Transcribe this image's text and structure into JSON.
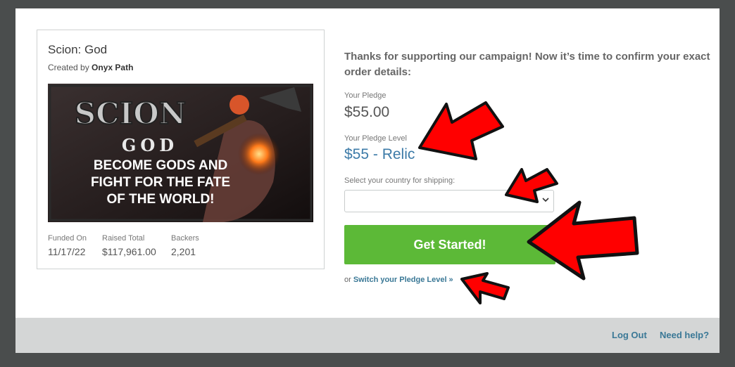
{
  "campaign": {
    "title": "Scion: God",
    "created_by_label": "Created by",
    "creator": "Onyx Path",
    "banner": {
      "logo": "SCION",
      "subtitle": "GOD",
      "tagline_1": "BECOME GODS AND",
      "tagline_2": "FIGHT FOR THE FATE",
      "tagline_3": "OF THE WORLD!"
    },
    "stats": [
      {
        "label": "Funded On",
        "value": "11/17/22"
      },
      {
        "label": "Raised Total",
        "value": "$117,961.00"
      },
      {
        "label": "Backers",
        "value": "2,201"
      }
    ]
  },
  "order": {
    "intro": "Thanks for supporting our campaign! Now it’s time to confirm your exact order details:",
    "pledge_label": "Your Pledge",
    "pledge_amount": "$55.00",
    "level_label": "Your Pledge Level",
    "level_value": "$55 - Relic",
    "country_label": "Select your country for shipping:",
    "country_value": "",
    "get_started": "Get Started!",
    "switch_prefix": "or",
    "switch_link": "Switch your Pledge Level »"
  },
  "footer": {
    "logout": "Log Out",
    "help": "Need help?"
  },
  "colors": {
    "accent_green": "#5cb937",
    "link_blue": "#3a7896",
    "annotation_red": "#ff0000"
  }
}
